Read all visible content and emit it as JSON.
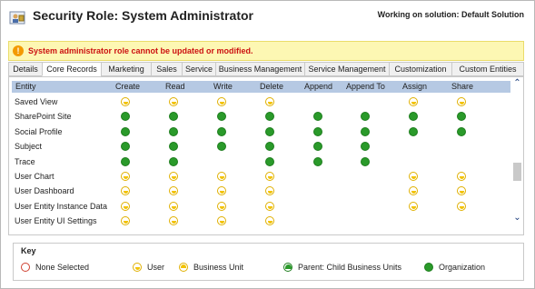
{
  "header": {
    "title": "Security Role: System Administrator",
    "solution": "Working on solution: Default Solution",
    "icon": "security-role-icon"
  },
  "warning": {
    "icon": "warning-icon",
    "text": "System administrator role cannot be updated or modified."
  },
  "tabs": [
    {
      "label": "Details",
      "active": false
    },
    {
      "label": "Core Records",
      "active": true
    },
    {
      "label": "Marketing",
      "active": false
    },
    {
      "label": "Sales",
      "active": false
    },
    {
      "label": "Service",
      "active": false
    },
    {
      "label": "Business Management",
      "active": false
    },
    {
      "label": "Service Management",
      "active": false
    },
    {
      "label": "Customization",
      "active": false
    },
    {
      "label": "Custom Entities",
      "active": false
    }
  ],
  "grid": {
    "columns": [
      "Entity",
      "Create",
      "Read",
      "Write",
      "Delete",
      "Append",
      "Append To",
      "Assign",
      "Share"
    ],
    "rows": [
      {
        "entity": "Saved View",
        "perms": [
          "user",
          "user",
          "user",
          "user",
          "",
          "",
          "user",
          "user"
        ]
      },
      {
        "entity": "SharePoint Site",
        "perms": [
          "org",
          "org",
          "org",
          "org",
          "org",
          "org",
          "org",
          "org"
        ]
      },
      {
        "entity": "Social Profile",
        "perms": [
          "org",
          "org",
          "org",
          "org",
          "org",
          "org",
          "org",
          "org"
        ]
      },
      {
        "entity": "Subject",
        "perms": [
          "org",
          "org",
          "org",
          "org",
          "org",
          "org",
          "",
          ""
        ]
      },
      {
        "entity": "Trace",
        "perms": [
          "org",
          "org",
          "",
          "org",
          "org",
          "org",
          "",
          ""
        ]
      },
      {
        "entity": "User Chart",
        "perms": [
          "user",
          "user",
          "user",
          "user",
          "",
          "",
          "user",
          "user"
        ]
      },
      {
        "entity": "User Dashboard",
        "perms": [
          "user",
          "user",
          "user",
          "user",
          "",
          "",
          "user",
          "user"
        ]
      },
      {
        "entity": "User Entity Instance Data",
        "perms": [
          "user",
          "user",
          "user",
          "user",
          "",
          "",
          "user",
          "user"
        ]
      },
      {
        "entity": "User Entity UI Settings",
        "perms": [
          "user",
          "user",
          "user",
          "user",
          "",
          "",
          "",
          ""
        ]
      }
    ]
  },
  "key": {
    "title": "Key",
    "items": [
      {
        "label": "None Selected",
        "icon": "none"
      },
      {
        "label": "User",
        "icon": "user"
      },
      {
        "label": "Business Unit",
        "icon": "bu"
      },
      {
        "label": "Parent: Child Business Units",
        "icon": "parent"
      },
      {
        "label": "Organization",
        "icon": "org"
      }
    ]
  },
  "colors": {
    "organization": "#2a9a2a",
    "user": "#f2c200",
    "header_band": "#b6c9e3",
    "warning_bg": "#fdf7b3",
    "warning_text": "#cc1111"
  }
}
